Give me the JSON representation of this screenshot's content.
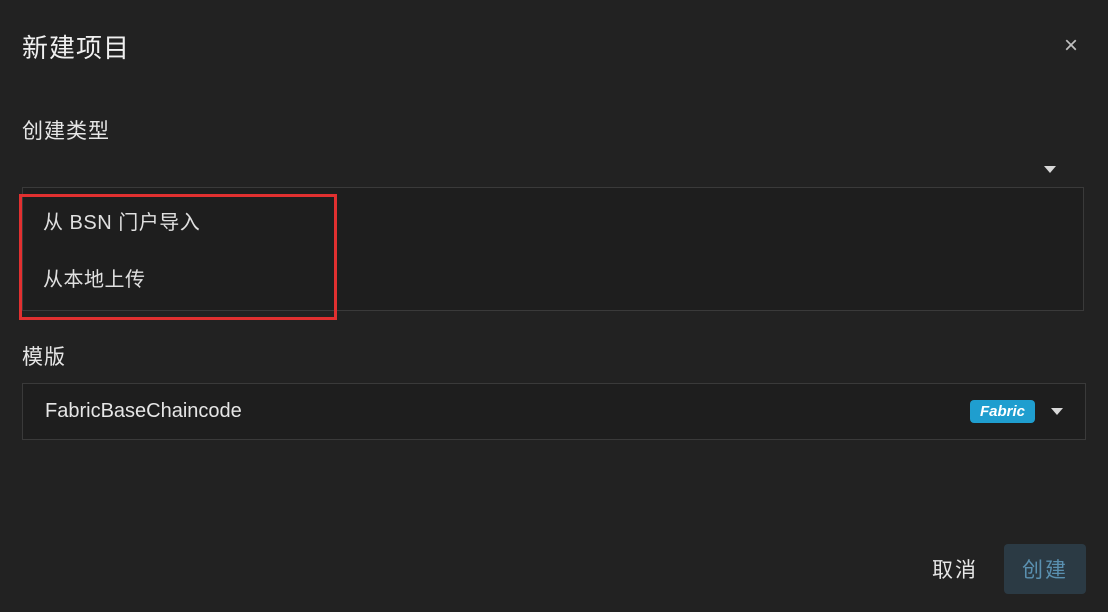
{
  "dialog": {
    "title": "新建项目",
    "close_label": "×"
  },
  "create_type": {
    "label": "创建类型",
    "selected": "",
    "options": [
      {
        "label": "从 BSN 门户导入"
      },
      {
        "label": "从本地上传"
      }
    ]
  },
  "template": {
    "label": "模版",
    "selected": "FabricBaseChaincode",
    "badge": "Fabric"
  },
  "footer": {
    "cancel": "取消",
    "create": "创建"
  }
}
